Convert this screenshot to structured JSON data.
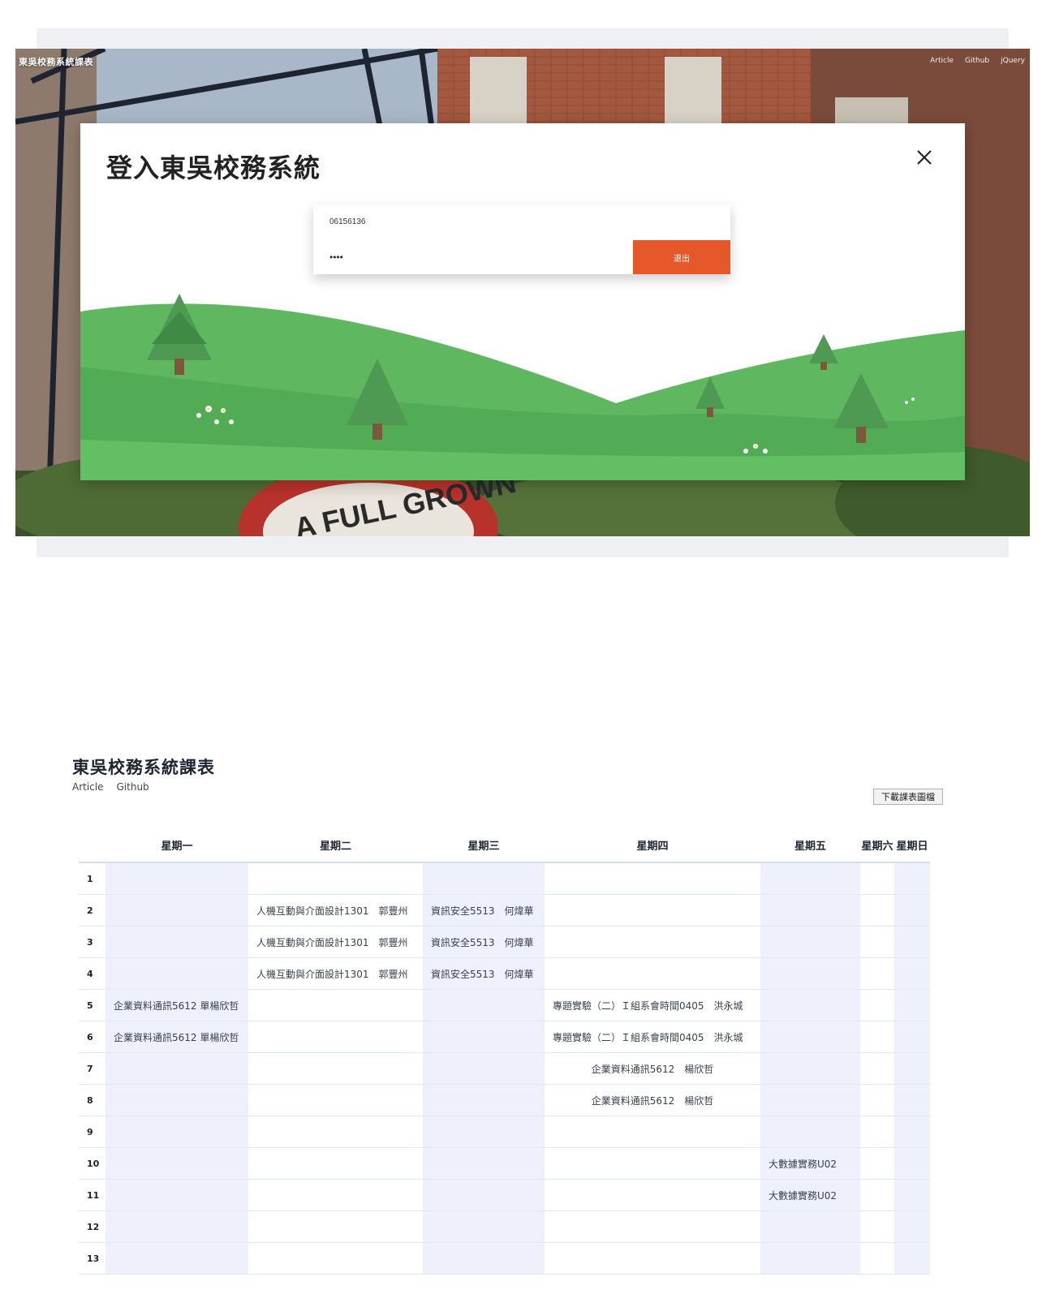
{
  "app": {
    "brand": "東吳校務系統課表",
    "nav": [
      "Article",
      "Github",
      "jQuery"
    ]
  },
  "login_modal": {
    "heading": "登入東吳校務系統",
    "username_value": "06156136",
    "password_value": "••••",
    "logout_label": "退出"
  },
  "schedule": {
    "title": "東吳校務系統課表",
    "nav": [
      "Article",
      "Github"
    ],
    "download_label": "下載課表圖檔",
    "days": [
      "星期一",
      "星期二",
      "星期三",
      "星期四",
      "星期五",
      "星期六",
      "星期日"
    ],
    "rows": [
      {
        "period": "1",
        "cells": [
          "",
          "",
          "",
          "",
          "",
          "",
          ""
        ]
      },
      {
        "period": "2",
        "cells": [
          "",
          "人機互動與介面設計1301　郭豐州",
          "資訊安全5513　何煒華",
          "",
          "",
          "",
          ""
        ]
      },
      {
        "period": "3",
        "cells": [
          "",
          "人機互動與介面設計1301　郭豐州",
          "資訊安全5513　何煒華",
          "",
          "",
          "",
          ""
        ]
      },
      {
        "period": "4",
        "cells": [
          "",
          "人機互動與介面設計1301　郭豐州",
          "資訊安全5513　何煒華",
          "",
          "",
          "",
          ""
        ]
      },
      {
        "period": "5",
        "cells": [
          "企業資料通訊5612 單楊欣哲",
          "",
          "",
          "專題實驗（二）Ｉ組系會時間0405　洪永城",
          "",
          "",
          ""
        ]
      },
      {
        "period": "6",
        "cells": [
          "企業資料通訊5612 單楊欣哲",
          "",
          "",
          "專題實驗（二）Ｉ組系會時間0405　洪永城",
          "",
          "",
          ""
        ]
      },
      {
        "period": "7",
        "cells": [
          "",
          "",
          "",
          "企業資料通訊5612　楊欣哲",
          "",
          "",
          ""
        ]
      },
      {
        "period": "8",
        "cells": [
          "",
          "",
          "",
          "企業資料通訊5612　楊欣哲",
          "",
          "",
          ""
        ]
      },
      {
        "period": "9",
        "cells": [
          "",
          "",
          "",
          "",
          "",
          "",
          ""
        ]
      },
      {
        "period": "10",
        "cells": [
          "",
          "",
          "",
          "",
          "大數據實務U02",
          "",
          ""
        ]
      },
      {
        "period": "11",
        "cells": [
          "",
          "",
          "",
          "",
          "大數據實務U02",
          "",
          ""
        ]
      },
      {
        "period": "12",
        "cells": [
          "",
          "",
          "",
          "",
          "",
          "",
          ""
        ]
      },
      {
        "period": "13",
        "cells": [
          "",
          "",
          "",
          "",
          "",
          "",
          ""
        ]
      }
    ]
  },
  "colors": {
    "accent_orange": "#e6572a",
    "grass_green": "#5cb85c",
    "column_shade": "#eef1fb"
  }
}
